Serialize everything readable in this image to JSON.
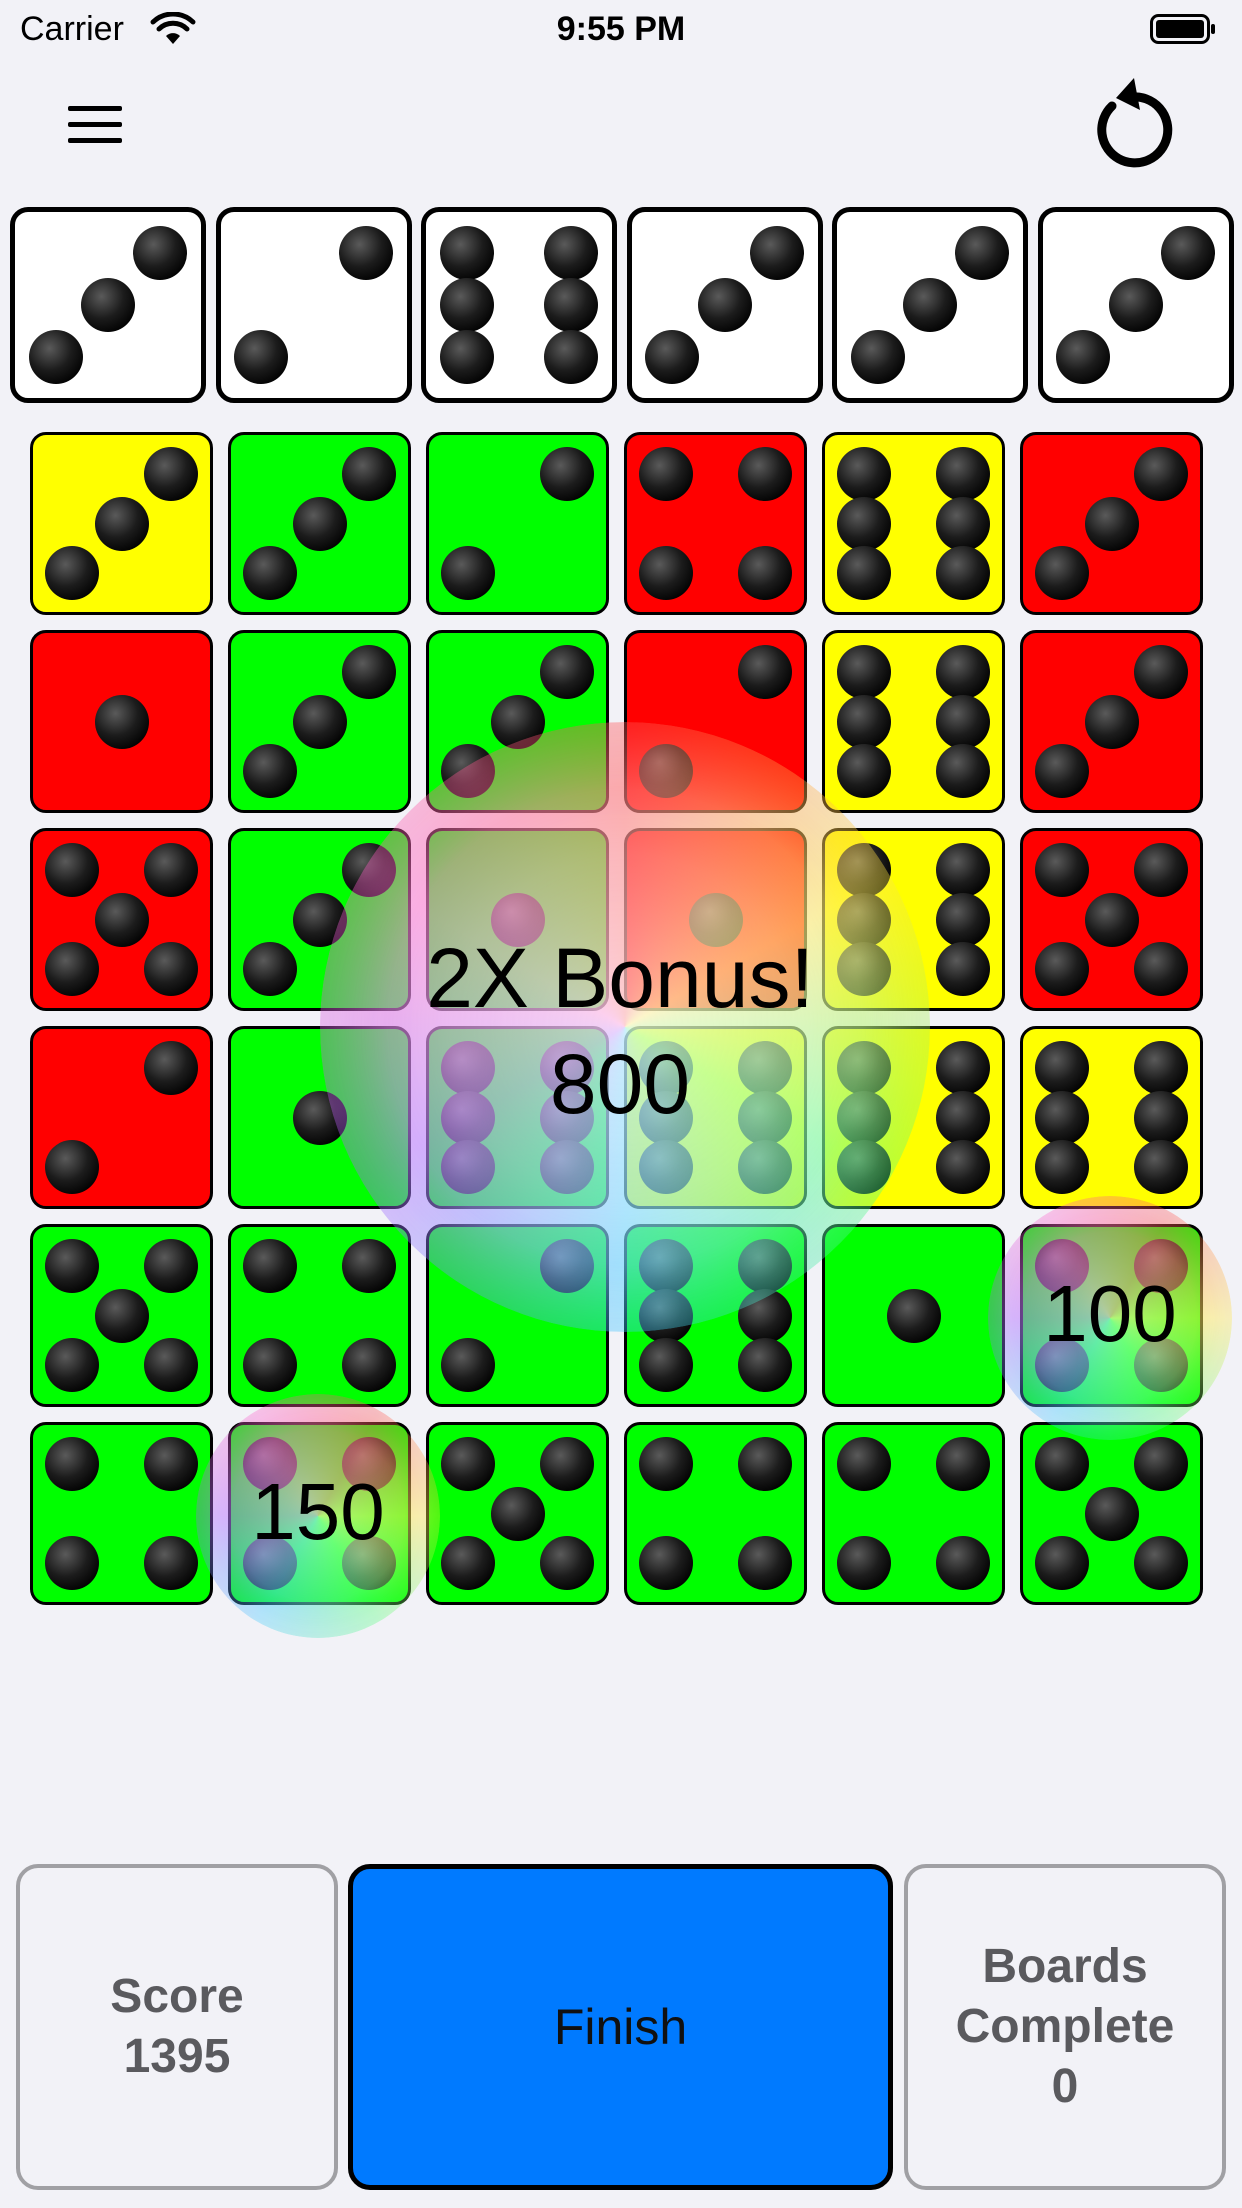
{
  "status_bar": {
    "carrier": "Carrier",
    "time": "9:55 PM"
  },
  "nav": {
    "menu_icon": "hamburger-menu-icon",
    "reset_icon": "restart-arrow-icon"
  },
  "rolled_dice": [
    3,
    2,
    6,
    3,
    3,
    3
  ],
  "board": [
    [
      {
        "value": 3,
        "color": "yellow"
      },
      {
        "value": 3,
        "color": "green"
      },
      {
        "value": 2,
        "color": "green"
      },
      {
        "value": 4,
        "color": "red"
      },
      {
        "value": 6,
        "color": "yellow"
      },
      {
        "value": 3,
        "color": "red"
      }
    ],
    [
      {
        "value": 1,
        "color": "red"
      },
      {
        "value": 3,
        "color": "green"
      },
      {
        "value": 3,
        "color": "green"
      },
      {
        "value": 2,
        "color": "red"
      },
      {
        "value": 6,
        "color": "yellow"
      },
      {
        "value": 3,
        "color": "red"
      }
    ],
    [
      {
        "value": 5,
        "color": "red"
      },
      {
        "value": 3,
        "color": "green"
      },
      {
        "value": 1,
        "color": "green"
      },
      {
        "value": 1,
        "color": "red"
      },
      {
        "value": 6,
        "color": "yellow"
      },
      {
        "value": 5,
        "color": "red"
      }
    ],
    [
      {
        "value": 2,
        "color": "red"
      },
      {
        "value": 1,
        "color": "green"
      },
      {
        "value": 6,
        "color": "green"
      },
      {
        "value": 6,
        "color": "yellow"
      },
      {
        "value": 6,
        "color": "yellow"
      },
      {
        "value": 6,
        "color": "yellow"
      }
    ],
    [
      {
        "value": 5,
        "color": "green"
      },
      {
        "value": 4,
        "color": "green"
      },
      {
        "value": 2,
        "color": "green"
      },
      {
        "value": 6,
        "color": "green"
      },
      {
        "value": 1,
        "color": "green"
      },
      {
        "value": 4,
        "color": "green"
      }
    ],
    [
      {
        "value": 4,
        "color": "green"
      },
      {
        "value": 4,
        "color": "green"
      },
      {
        "value": 5,
        "color": "green"
      },
      {
        "value": 4,
        "color": "green"
      },
      {
        "value": 4,
        "color": "green"
      },
      {
        "value": 5,
        "color": "green"
      }
    ]
  ],
  "colors": {
    "yellow": "#ffff00",
    "green": "#00ff00",
    "red": "#ff0000",
    "finish_button": "#007aff"
  },
  "popups": {
    "bonus_title": "2X Bonus!",
    "bonus_points": "800",
    "points_a": "100",
    "points_b": "150"
  },
  "footer": {
    "score_label": "Score",
    "score_value": "1395",
    "finish_label": "Finish",
    "boards_label_line1": "Boards",
    "boards_label_line2": "Complete",
    "boards_value": "0"
  }
}
